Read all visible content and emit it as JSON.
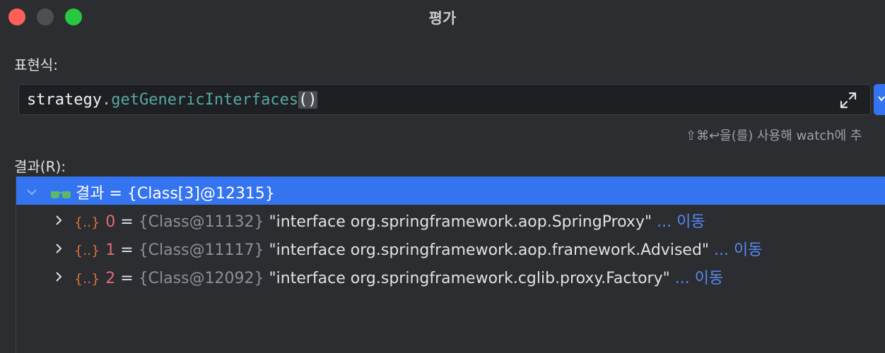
{
  "window": {
    "title": "평가"
  },
  "expression": {
    "label": "표현식:",
    "object": "strategy",
    "dot": ".",
    "method": "getGenericInterfaces",
    "parens": "()"
  },
  "hint": "⇧⌘↩을(를) 사용해 watch에 추",
  "result": {
    "label": "결과(R):",
    "root": {
      "name": "결과",
      "eq": " = ",
      "value": "{Class[3]@12315}"
    },
    "items": [
      {
        "index": "0",
        "ref": "{Class@11132}",
        "value": "\"interface org.springframework.aop.SpringProxy\"",
        "nav": "... 이동"
      },
      {
        "index": "1",
        "ref": "{Class@11117}",
        "value": "\"interface org.springframework.aop.framework.Advised\"",
        "nav": "... 이동"
      },
      {
        "index": "2",
        "ref": "{Class@12092}",
        "value": "\"interface org.springframework.cglib.proxy.Factory\"",
        "nav": "... 이동"
      }
    ],
    "item_icon_text": "{..}",
    "eq": " = "
  },
  "icons": {
    "expand": "expand-icon",
    "dropdown": "chevron-down-icon",
    "tree_expanded": "chevron-down-icon",
    "tree_collapsed": "chevron-right-icon",
    "watch": "glasses-icon",
    "object": "object-brace-icon"
  },
  "colors": {
    "window_bg": "#2b2d30",
    "selection": "#3574f0",
    "method": "#56a8a5",
    "index": "#e06c75",
    "link": "#548af7"
  }
}
